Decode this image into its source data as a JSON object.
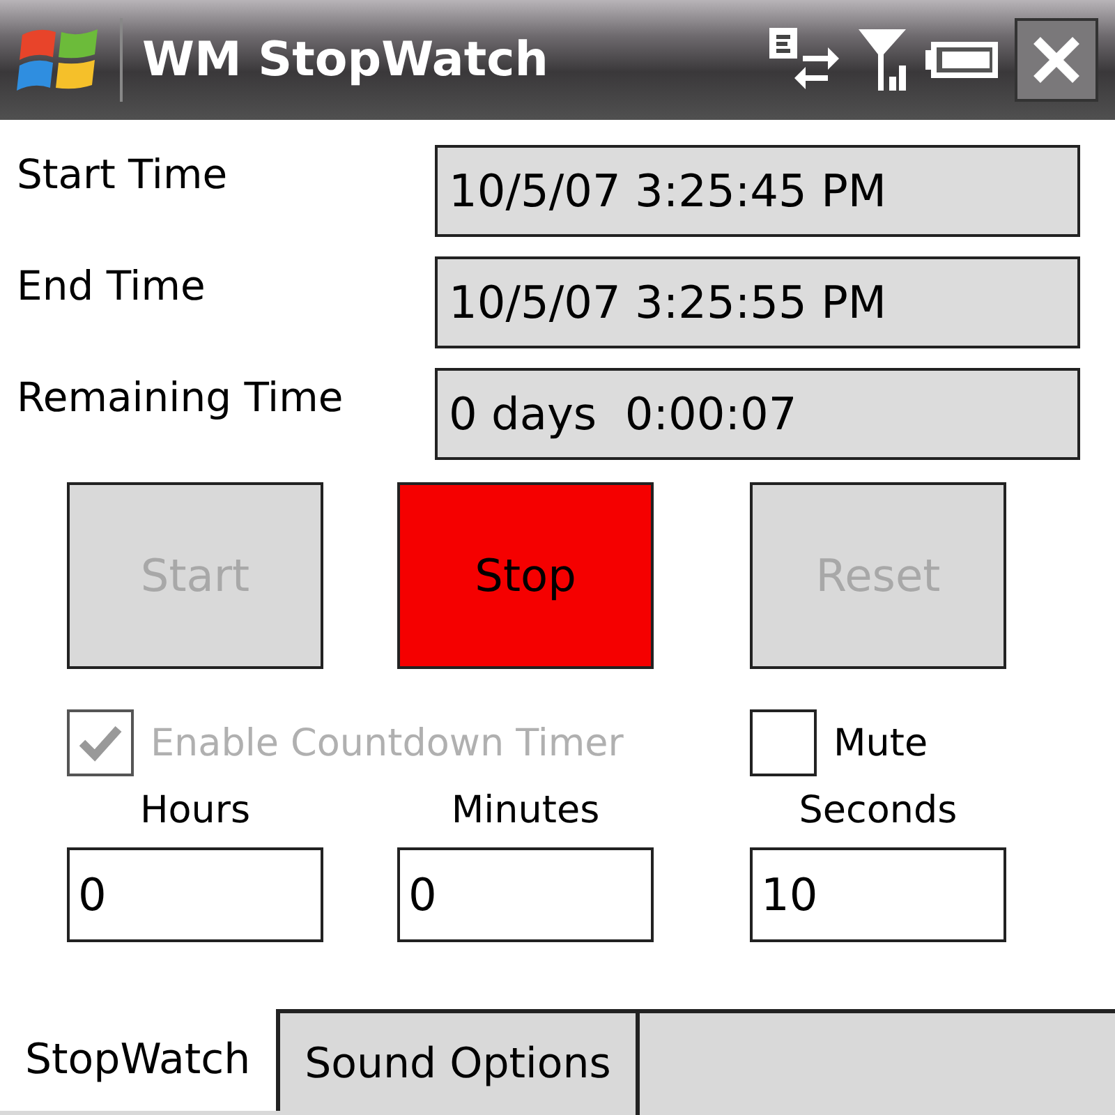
{
  "window": {
    "title": "WM StopWatch"
  },
  "times": [
    {
      "label": "Start Time",
      "value": "10/5/07 3:25:45 PM"
    },
    {
      "label": "End Time",
      "value": "10/5/07 3:25:55 PM"
    },
    {
      "label": "Remaining Time",
      "value": "0 days  0:00:07"
    }
  ],
  "buttons": [
    {
      "label": "Start",
      "disabled": true,
      "color": "#d9d9d9"
    },
    {
      "label": "Stop",
      "disabled": false,
      "color": "#f50000"
    },
    {
      "label": "Reset",
      "disabled": true,
      "color": "#d9d9d9"
    }
  ],
  "checkboxes": [
    {
      "label": "Enable Countdown Timer",
      "checked": true,
      "disabled": true
    },
    {
      "label": "Mute",
      "checked": false,
      "disabled": false
    }
  ],
  "countdown": [
    {
      "label": "Hours",
      "value": "0"
    },
    {
      "label": "Minutes",
      "value": "0"
    },
    {
      "label": "Seconds",
      "value": "10"
    }
  ],
  "tabs": [
    {
      "label": "StopWatch",
      "selected": true
    },
    {
      "label": "Sound Options",
      "selected": false
    }
  ]
}
